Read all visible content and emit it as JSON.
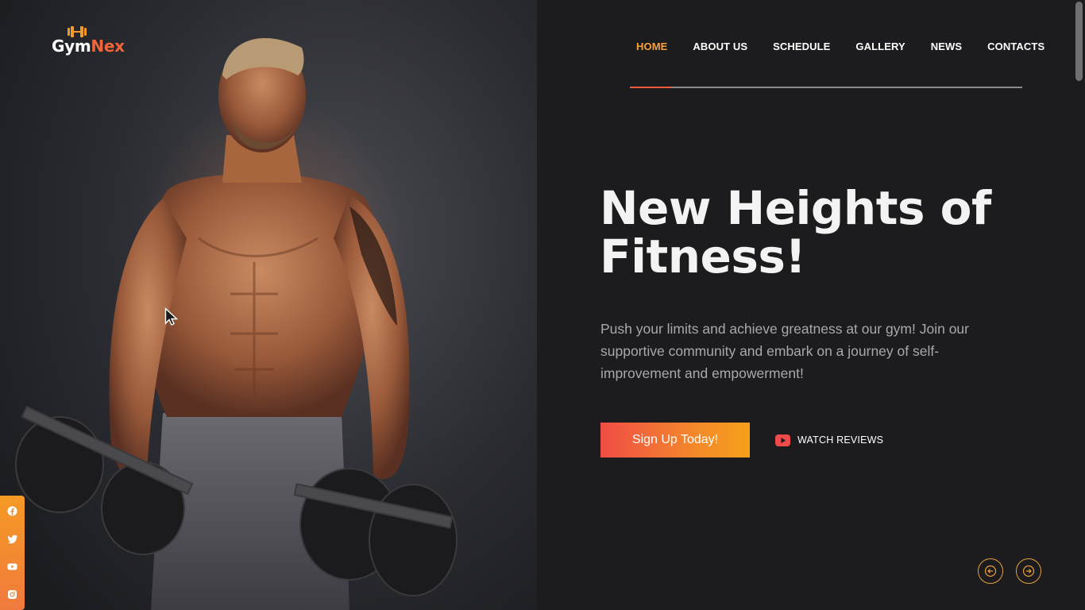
{
  "brand": {
    "logo_part1": "Gym",
    "logo_part2": "Nex",
    "accent": "#f2643a",
    "nav_active_color": "#f7a03c"
  },
  "nav": {
    "items": [
      {
        "label": "HOME"
      },
      {
        "label": "ABOUT US"
      },
      {
        "label": "SCHEDULE"
      },
      {
        "label": "GALLERY"
      },
      {
        "label": "NEWS"
      },
      {
        "label": "CONTACTS"
      }
    ],
    "active_index": 0
  },
  "hero": {
    "title_line1": "New Heights of",
    "title_line2": "Fitness!",
    "description": "Push your limits and achieve greatness at our gym! Join our supportive community and embark on a journey of self-improvement and empowerment!",
    "cta_label": "Sign Up Today!",
    "watch_label": "WATCH REVIEWS",
    "image_subject": "muscular man holding dumbbells"
  },
  "slider": {
    "prev_icon": "arrow-left-circle-icon",
    "next_icon": "arrow-right-circle-icon"
  },
  "social": {
    "icons": [
      "facebook-icon",
      "twitter-icon",
      "youtube-icon",
      "instagram-icon"
    ],
    "bar_color": "#f59a24"
  }
}
